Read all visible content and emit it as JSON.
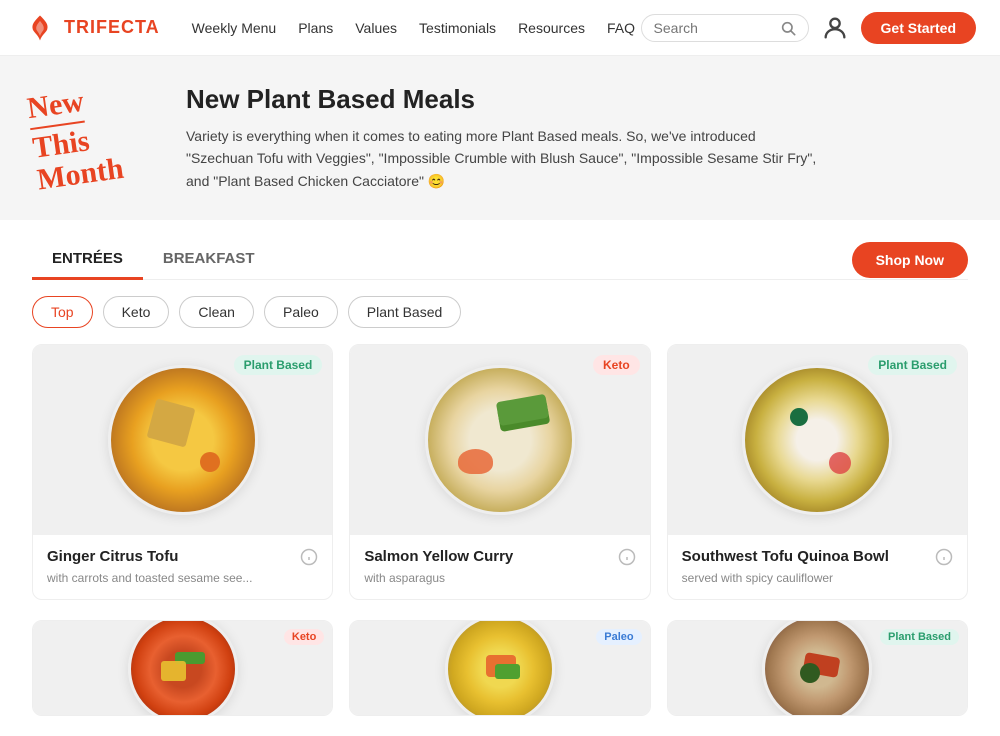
{
  "brand": {
    "name": "TRIFECTA",
    "logo_alt": "Trifecta logo"
  },
  "nav": {
    "links": [
      {
        "label": "Weekly Menu",
        "href": "#"
      },
      {
        "label": "Plans",
        "href": "#"
      },
      {
        "label": "Values",
        "href": "#"
      },
      {
        "label": "Testimonials",
        "href": "#"
      },
      {
        "label": "Resources",
        "href": "#"
      },
      {
        "label": "FAQ",
        "href": "#"
      }
    ],
    "search_placeholder": "Search",
    "get_started_label": "Get Started"
  },
  "banner": {
    "badge_line1": "New",
    "badge_line2": "This",
    "badge_line3": "Month",
    "title": "New Plant Based Meals",
    "description": "Variety is everything when it comes to eating more Plant Based meals. So, we've introduced \"Szechuan Tofu with Veggies\", \"Impossible Crumble with Blush Sauce\", \"Impossible Sesame Stir Fry\", and \"Plant Based Chicken Cacciatore\" 😊"
  },
  "tabs": [
    {
      "label": "ENTRÉES",
      "active": true
    },
    {
      "label": "BREAKFAST",
      "active": false
    }
  ],
  "shop_now_label": "Shop Now",
  "filters": [
    {
      "label": "Top",
      "active": true
    },
    {
      "label": "Keto",
      "active": false
    },
    {
      "label": "Clean",
      "active": false
    },
    {
      "label": "Paleo",
      "active": false
    },
    {
      "label": "Plant Based",
      "active": false
    }
  ],
  "meals": [
    {
      "name": "Ginger Citrus Tofu",
      "description": "with carrots and toasted sesame see...",
      "badge": "Plant Based",
      "badge_type": "plant",
      "plate_class": "plate-1"
    },
    {
      "name": "Salmon Yellow Curry",
      "description": "with asparagus",
      "badge": "Keto",
      "badge_type": "keto",
      "plate_class": "plate-2"
    },
    {
      "name": "Southwest Tofu Quinoa Bowl",
      "description": "served with spicy cauliflower",
      "badge": "Plant Based",
      "badge_type": "plant",
      "plate_class": "plate-3"
    }
  ],
  "partial_meals": [
    {
      "badge": "Keto",
      "badge_type": "keto",
      "plate_class": "plate-4"
    },
    {
      "badge": "Paleo",
      "badge_type": "paleo",
      "plate_class": "plate-5"
    },
    {
      "badge": "Plant Based",
      "badge_type": "plant",
      "plate_class": "plate-6"
    }
  ]
}
